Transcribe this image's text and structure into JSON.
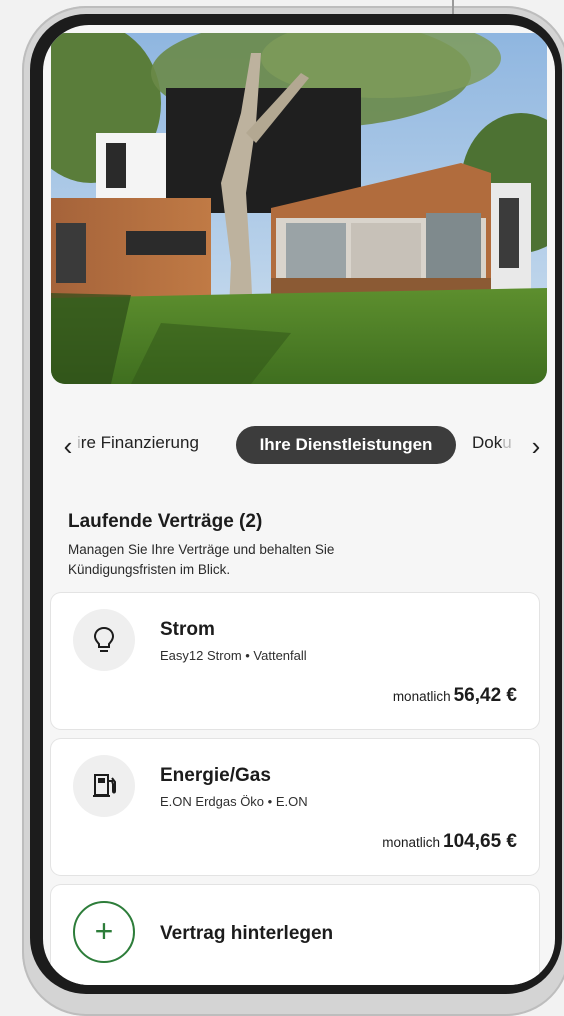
{
  "tabs": {
    "prev_partial": "re Finanzierung",
    "prev_fade": "i",
    "active": "Ihre Dienstleistungen",
    "next_partial": "Dok",
    "next_fade": "u"
  },
  "contracts": {
    "heading": "Laufende Verträge (2)",
    "description": "Managen Sie Ihre Verträge und behalten Sie Kündigungsfristen im Blick.",
    "items": [
      {
        "title": "Strom",
        "subtitle": "Easy12 Strom • Vattenfall",
        "period": "monatlich",
        "amount": "56,42 €",
        "icon": "lightbulb-icon"
      },
      {
        "title": "Energie/Gas",
        "subtitle": "E.ON Erdgas Öko • E.ON",
        "period": "monatlich",
        "amount": "104,65 €",
        "icon": "gas-pump-icon"
      }
    ],
    "add": {
      "label": "Vertrag hinterlegen",
      "icon": "plus-icon"
    }
  },
  "colors": {
    "active_tab_bg": "#3c3c3c",
    "accent_green": "#2d7d3a"
  }
}
